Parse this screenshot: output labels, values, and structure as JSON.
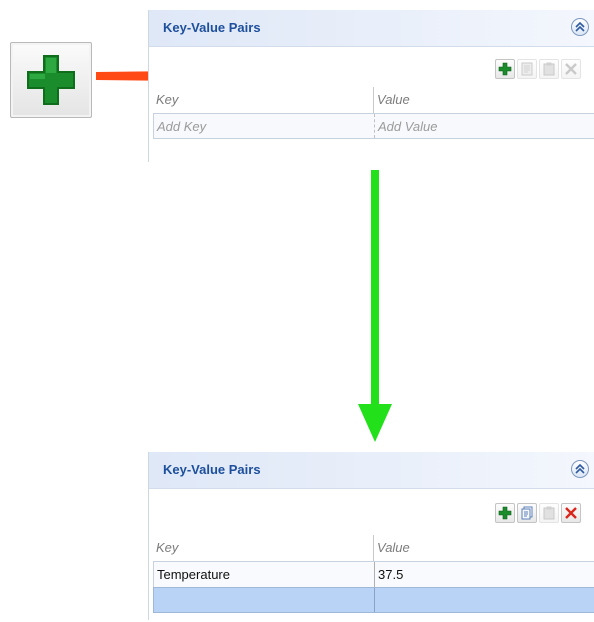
{
  "zoom_icon": {
    "icon": "add-icon",
    "color": "#1a8c2c"
  },
  "arrows": {
    "top_color": "#ff4a16",
    "down_color": "#22e01a"
  },
  "panel_before": {
    "title": "Key-Value Pairs",
    "collapse_icon": "double-chevron-up-icon",
    "toolbar": [
      "add-icon",
      "copy-icon",
      "paste-icon",
      "delete-icon"
    ],
    "columns": {
      "key": "Key",
      "value": "Value"
    },
    "new_row": {
      "key_placeholder": "Add Key",
      "value_placeholder": "Add Value"
    }
  },
  "panel_after": {
    "title": "Key-Value Pairs",
    "collapse_icon": "double-chevron-up-icon",
    "toolbar": [
      "add-icon",
      "copy-icon",
      "paste-icon",
      "delete-icon"
    ],
    "columns": {
      "key": "Key",
      "value": "Value"
    },
    "rows": [
      {
        "key": "Temperature",
        "value": "37.5"
      }
    ],
    "selected_row": {
      "key": "",
      "value": ""
    }
  }
}
